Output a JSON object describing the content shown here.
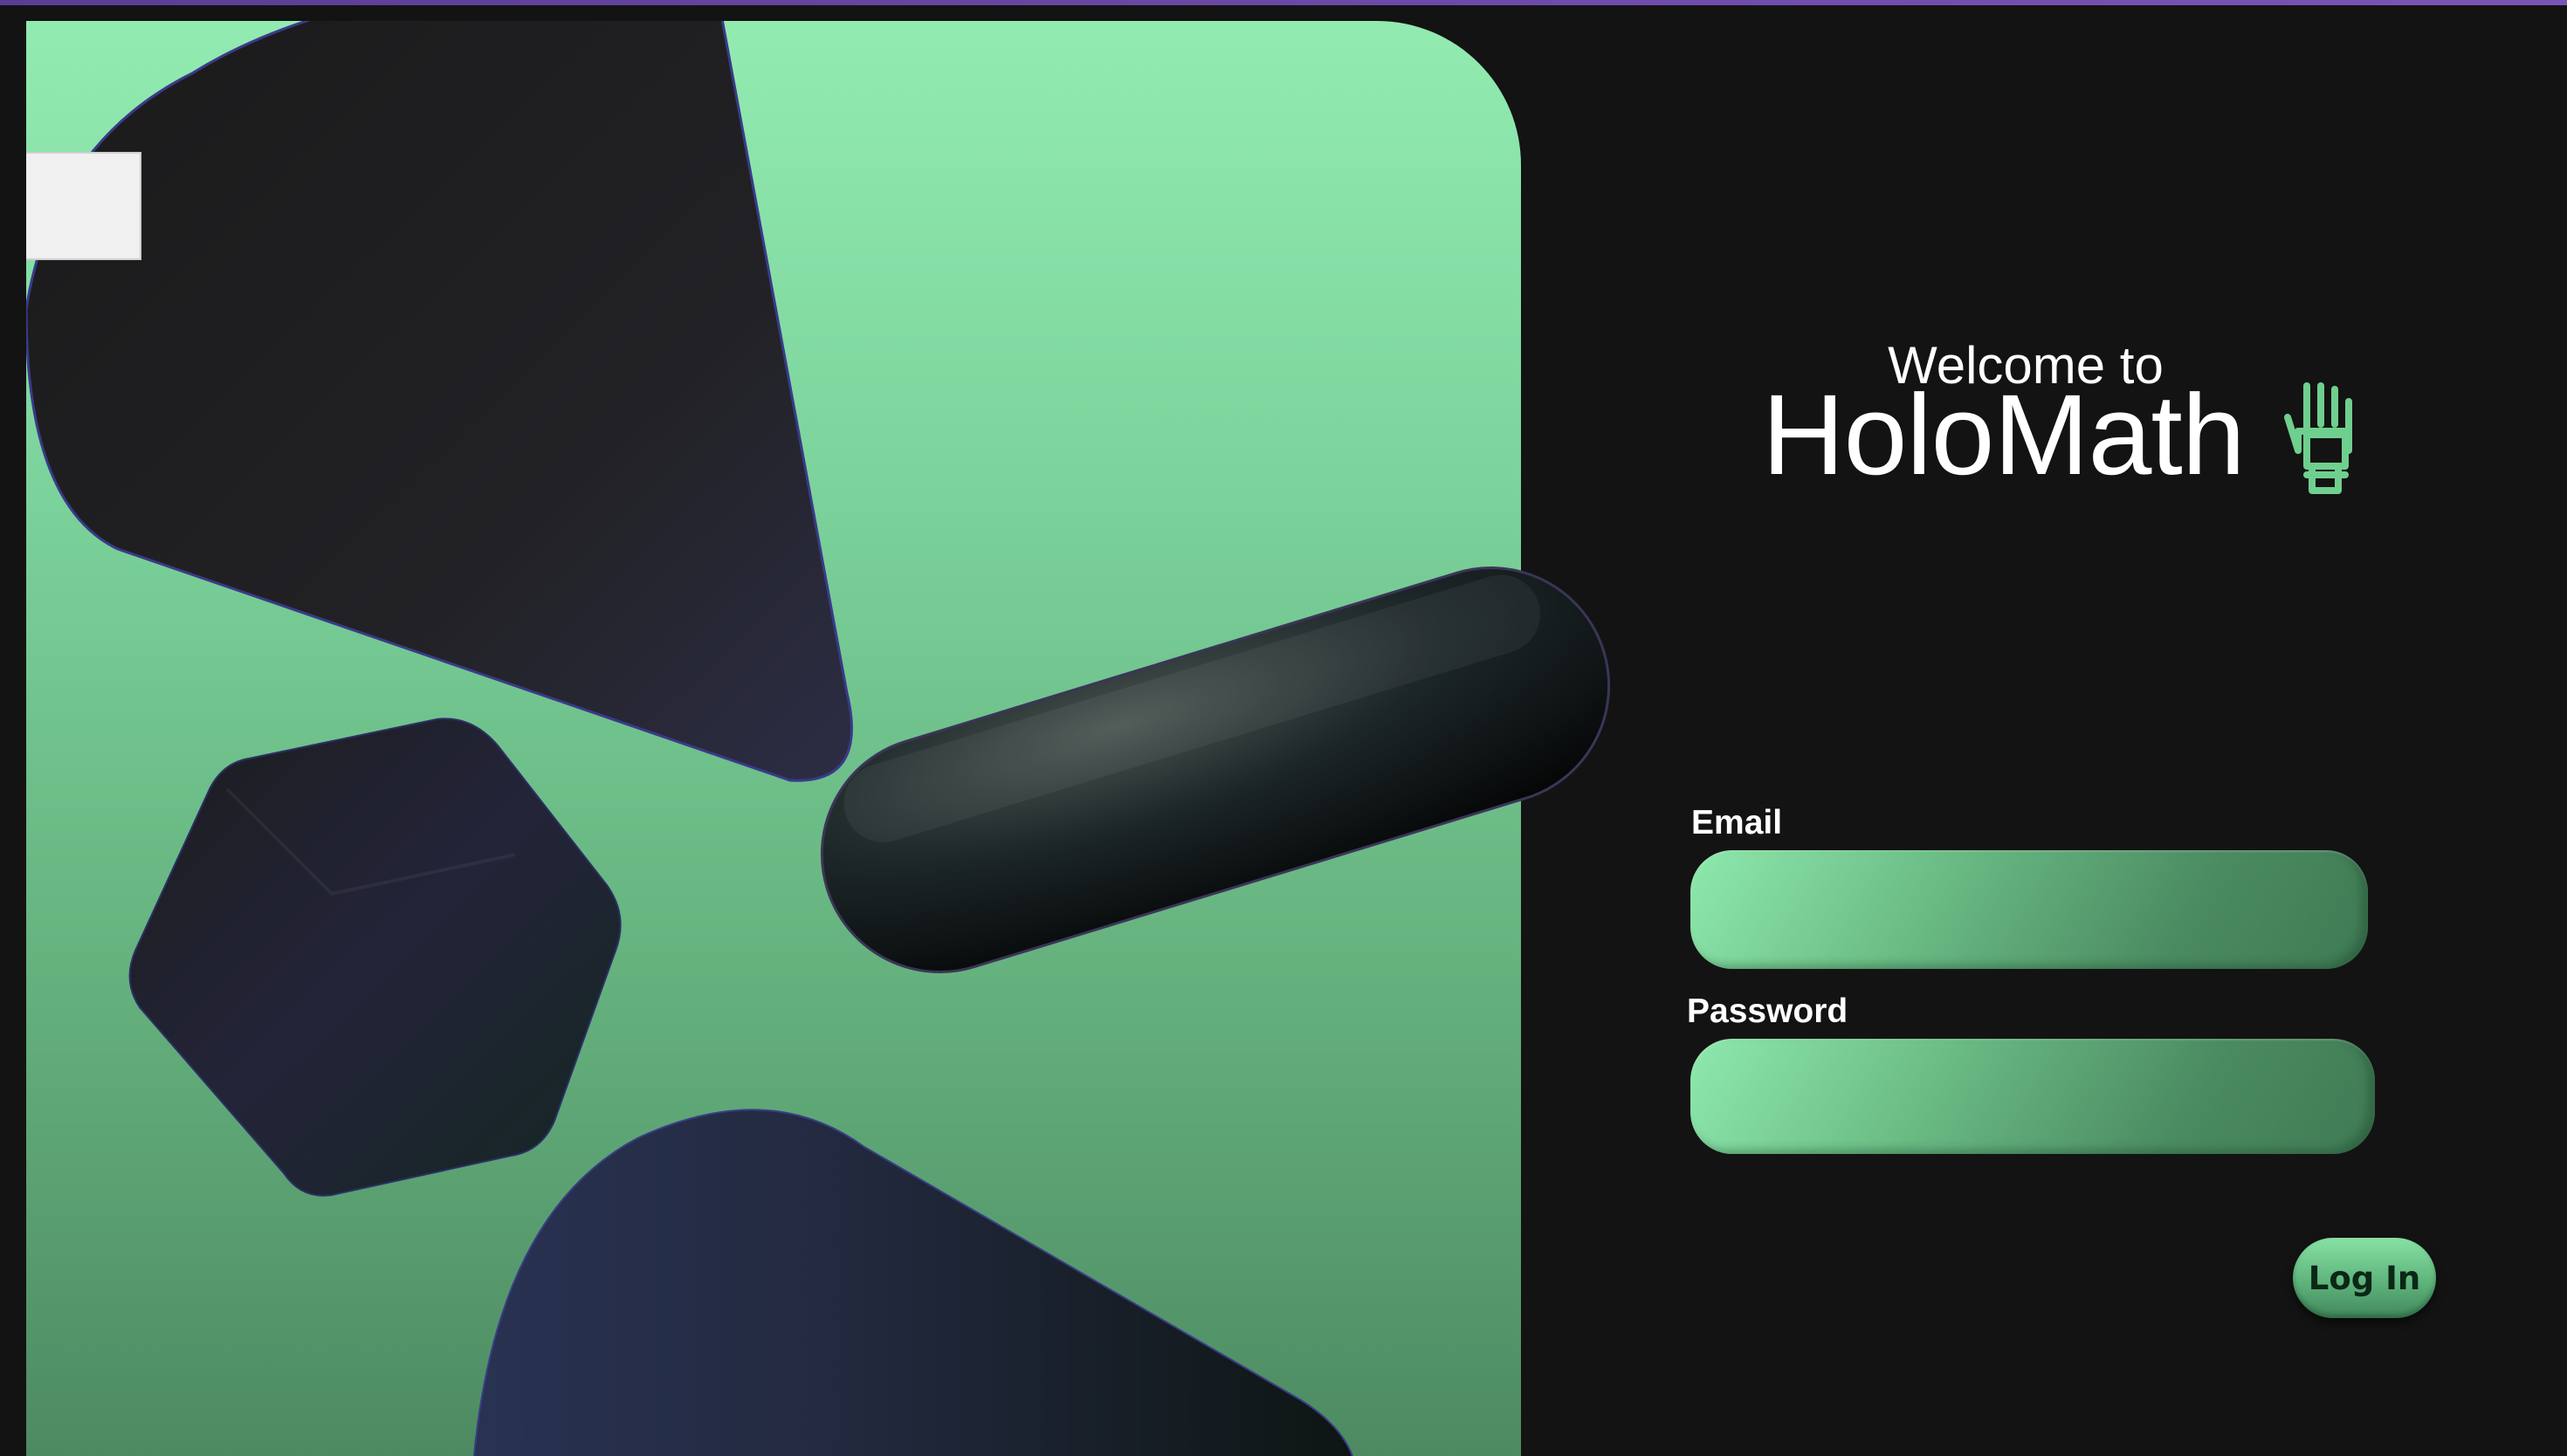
{
  "header": {
    "welcome_text": "Welcome to",
    "app_name": "HoloMath"
  },
  "form": {
    "email": {
      "label": "Email",
      "value": "",
      "placeholder": ""
    },
    "password": {
      "label": "Password",
      "value": "",
      "placeholder": ""
    },
    "submit_label": "Log In"
  },
  "icons": {
    "logo": "robotic-hand-icon"
  },
  "colors": {
    "page_background": "#131313",
    "accent_green": "#6fcf8e",
    "hero_top": "#92ebb1",
    "hero_bottom": "#4d8a62",
    "window_strip": "#6b4aa8",
    "text": "#ffffff"
  }
}
